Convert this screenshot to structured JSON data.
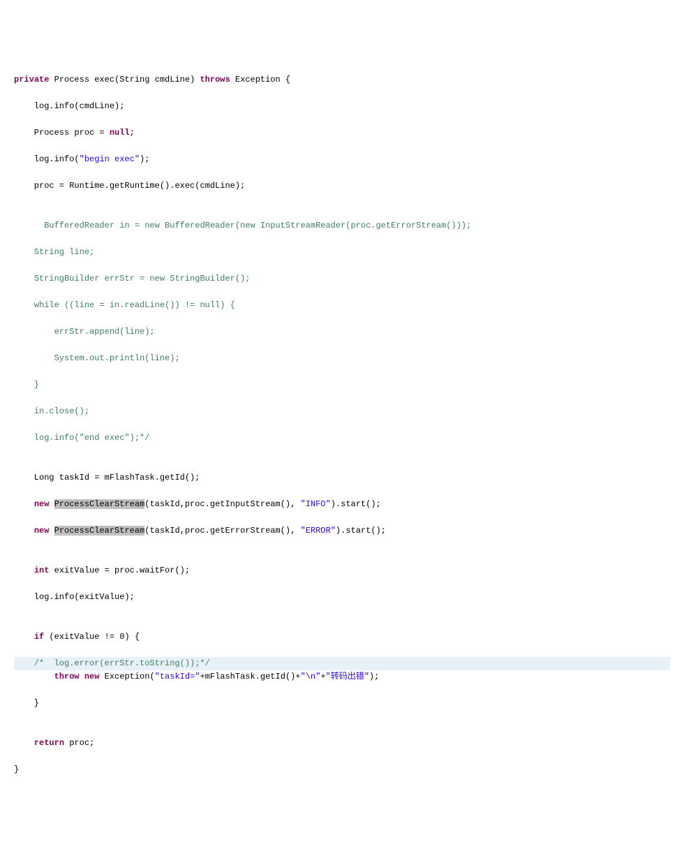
{
  "code": {
    "l1a": "private",
    "l1b": " Process exec(String cmdLine) ",
    "l1c": "throws",
    "l1d": " Exception {",
    "l2": "    log.info(cmdLine);",
    "l3a": "    Process proc = ",
    "l3b": "null",
    "l3c": ";",
    "l4a": "    log.info(",
    "l4b": "\"begin exec\"",
    "l4c": ");",
    "l5": "    proc = Runtime.getRuntime().exec(cmdLine);",
    "l6": "",
    "l7": "      BufferedReader in = new BufferedReader(new InputStreamReader(proc.getErrorStream()));",
    "l8": "    String line;",
    "l9": "    StringBuilder errStr = new StringBuilder();",
    "l10": "    while ((line = in.readLine()) != null) {",
    "l11": "        errStr.append(line);",
    "l12": "        System.out.println(line);",
    "l13": "    }",
    "l14": "    in.close();",
    "l15": "    log.info(\"end exec\");*/",
    "l16": "",
    "l17": "    Long taskId = mFlashTask.getId();",
    "l18a": "    ",
    "l18b": "new",
    "l18c": " ",
    "l18d": "ProcessClearStream",
    "l18e": "(taskId,proc.getInputStream(), ",
    "l18f": "\"INFO\"",
    "l18g": ").start();",
    "l19a": "    ",
    "l19b": "new",
    "l19c": " ",
    "l19d": "ProcessClearStream",
    "l19e": "(taskId,proc.getErrorStream(), ",
    "l19f": "\"ERROR\"",
    "l19g": ").start();",
    "l20": "",
    "l21a": "    ",
    "l21b": "int",
    "l21c": " exitValue = proc.waitFor();",
    "l22": "    log.info(exitValue);",
    "l23": "",
    "l24a": "    ",
    "l24b": "if",
    "l24c": " (exitValue != 0) {",
    "l25": "    /*  log.error(errStr.toString());*/",
    "l26a": "        ",
    "l26b": "throw",
    "l26c": " ",
    "l26d": "new",
    "l26e": " Exception(",
    "l26f": "\"taskId=\"",
    "l26g": "+mFlashTask.getId()+",
    "l26h": "\"\\n\"",
    "l26i": "+",
    "l26j": "\"转码出错\"",
    "l26k": ");",
    "l27": "    }",
    "l28": "",
    "l29a": "    ",
    "l29b": "return",
    "l29c": " proc;",
    "l30": "}"
  }
}
